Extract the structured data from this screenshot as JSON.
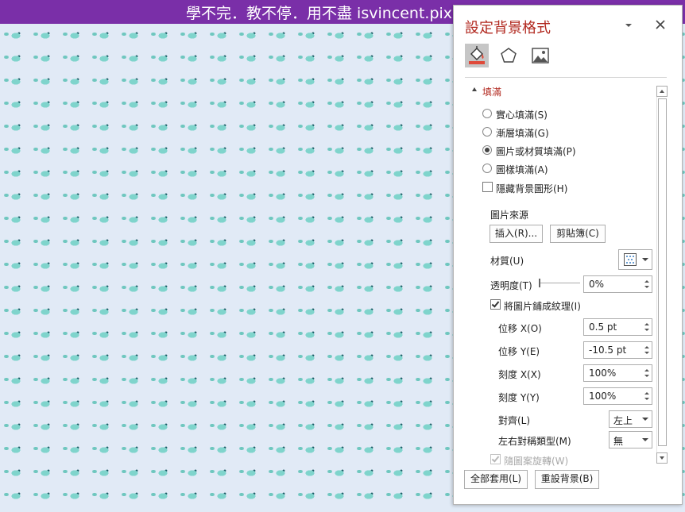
{
  "slide": {
    "title": "學不完．教不停．用不盡 isvincent.pixnet.net",
    "background_color": "#e1eaf6",
    "pattern_icon": "fish-icon",
    "pattern_color": "#7fd4cc",
    "title_bar_color": "#7a2fa8"
  },
  "pane": {
    "title": "設定背景格式",
    "title_color": "#b1271e",
    "tabs": [
      {
        "name": "fill-tab",
        "icon": "paint-bucket-icon",
        "active": true
      },
      {
        "name": "effects-tab",
        "icon": "pentagon-icon",
        "active": false
      },
      {
        "name": "picture-tab",
        "icon": "picture-icon",
        "active": false
      }
    ],
    "section": {
      "label": "填滿"
    },
    "fill_options": [
      {
        "label": "實心填滿(S)",
        "checked": false
      },
      {
        "label": "漸層填滿(G)",
        "checked": false
      },
      {
        "label": "圖片或材質填滿(P)",
        "checked": true
      },
      {
        "label": "圖樣填滿(A)",
        "checked": false
      }
    ],
    "hide_background_graphics": {
      "label": "隱藏背景圖形(H)",
      "checked": false
    },
    "picture_source": {
      "label": "圖片來源",
      "insert_button": "插入(R)...",
      "clipboard_button": "剪貼簿(C)"
    },
    "texture": {
      "label": "材質(U)",
      "icon": "texture-dots-icon"
    },
    "transparency": {
      "label": "透明度(T)",
      "value": "0%",
      "slider_percent": 0
    },
    "tile_as_texture": {
      "label": "將圖片鋪成紋理(I)",
      "checked": true
    },
    "offset_x": {
      "label": "位移 X(O)",
      "value": "0.5 pt"
    },
    "offset_y": {
      "label": "位移 Y(E)",
      "value": "-10.5 pt"
    },
    "scale_x": {
      "label": "刻度 X(X)",
      "value": "100%"
    },
    "scale_y": {
      "label": "刻度 Y(Y)",
      "value": "100%"
    },
    "alignment": {
      "label": "對齊(L)",
      "value": "左上"
    },
    "mirror_type": {
      "label": "左右對稱類型(M)",
      "value": "無"
    },
    "rotate_with_shape": {
      "label": "隨圖案旋轉(W)",
      "checked": true,
      "disabled": true
    },
    "apply_all_button": "全部套用(L)",
    "reset_button": "重設背景(B)"
  }
}
